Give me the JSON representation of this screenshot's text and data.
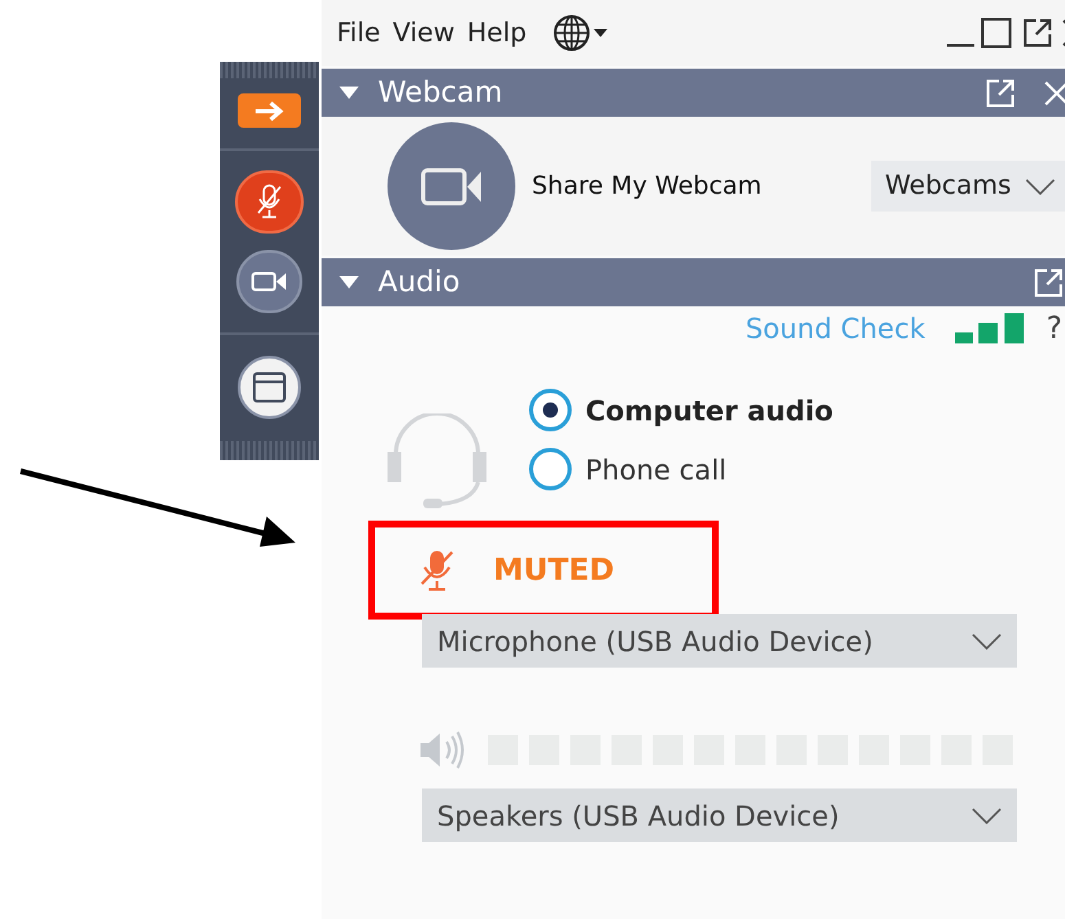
{
  "menu": [
    {
      "label": "File"
    },
    {
      "label": "View"
    },
    {
      "label": "Help"
    }
  ],
  "toolbar": {
    "muted": true
  },
  "webcam": {
    "title": "Webcam",
    "expanded": true,
    "share_label": "Share My Webcam",
    "select": "Webcams"
  },
  "audio": {
    "title": "Audio",
    "expanded": true,
    "sound_check": "Sound Check",
    "help": "?",
    "options": [
      {
        "label": "Computer audio",
        "selected": true
      },
      {
        "label": "Phone call",
        "selected": false
      }
    ],
    "mute_status": "MUTED",
    "microphone": "Microphone (USB Audio Device)",
    "speakers": "Speakers (USB Audio Device)"
  }
}
